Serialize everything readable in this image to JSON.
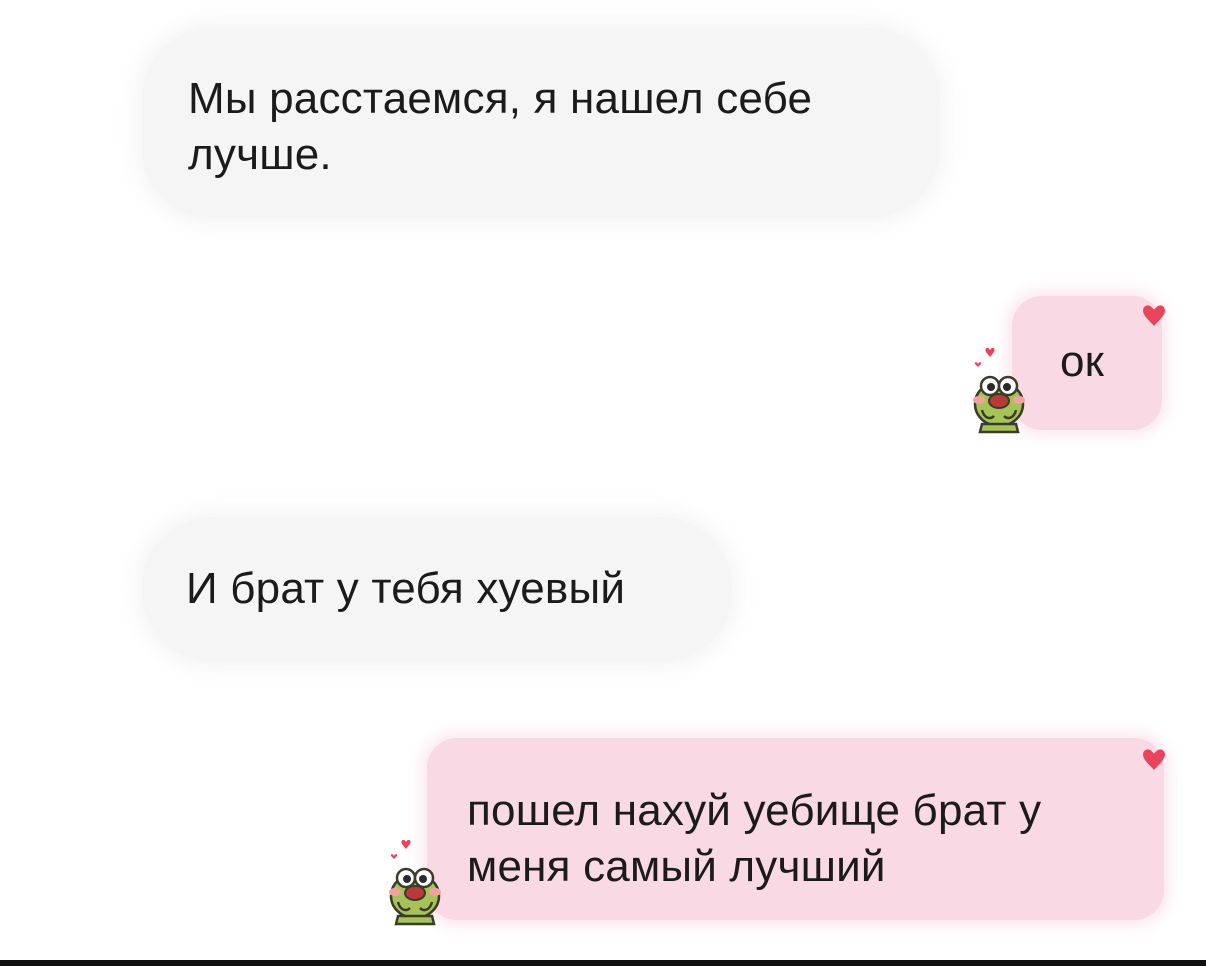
{
  "messages": [
    {
      "sender": "them",
      "text": "Мы расстаемся, я нашел себе лучше."
    },
    {
      "sender": "me",
      "text": "ок",
      "reaction": "heart-icon"
    },
    {
      "sender": "them",
      "text": "И брат у тебя хуевый"
    },
    {
      "sender": "me",
      "text": "пошел нахуй уебище брат у меня самый лучший",
      "reaction": "heart-icon"
    }
  ],
  "colors": {
    "incoming_bubble": "#f5f5f5",
    "outgoing_bubble": "#f9d9e3",
    "heart": "#e8455c",
    "frog": "#a6c35a"
  },
  "icons": [
    "heart-icon",
    "frog-sticker-icon"
  ]
}
